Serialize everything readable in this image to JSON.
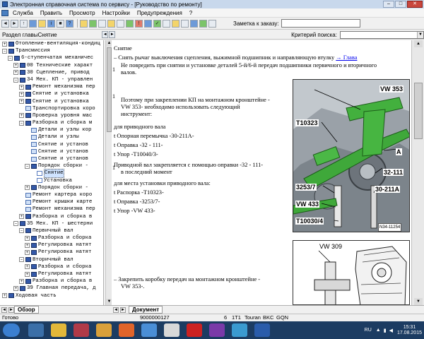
{
  "titlebar": {
    "title": "Электронная справочная система по сервису - [Руководство по ремонту]",
    "min": "–",
    "max": "□",
    "close": "✕"
  },
  "menu": [
    "Служба",
    "Править",
    "Просмотр",
    "Настройки",
    "Предупреждения",
    "?"
  ],
  "toolbar": {
    "order_label": "Заметка к заказу:"
  },
  "crumb": {
    "section": "Раздел главыСнятие",
    "search_label": "Критерий  поиска:"
  },
  "tree": [
    {
      "indent": 0,
      "ex": "+",
      "icon": "book",
      "label": "Отопление-вентиляция-кондиц"
    },
    {
      "indent": 0,
      "ex": "–",
      "icon": "book",
      "label": "Трансмиссия"
    },
    {
      "indent": 1,
      "ex": "–",
      "icon": "book",
      "label": "6-ступенчатая механичес"
    },
    {
      "indent": 2,
      "ex": "+",
      "icon": "book",
      "label": "00 Технические характ"
    },
    {
      "indent": 2,
      "ex": "+",
      "icon": "book",
      "label": "30 Сцепление, привод"
    },
    {
      "indent": 2,
      "ex": "–",
      "icon": "book",
      "label": "34 Мех. КП - управлен"
    },
    {
      "indent": 3,
      "ex": "+",
      "icon": "book",
      "label": "Ремонт механизма пер"
    },
    {
      "indent": 3,
      "ex": "+",
      "icon": "book",
      "label": "Снятие и установка"
    },
    {
      "indent": 3,
      "ex": "+",
      "icon": "book",
      "label": "Снятие и установка"
    },
    {
      "indent": 3,
      "ex": "",
      "icon": "doc2",
      "label": "Транспортировка коро"
    },
    {
      "indent": 3,
      "ex": "+",
      "icon": "book",
      "label": "Проверка уровня мас"
    },
    {
      "indent": 3,
      "ex": "–",
      "icon": "book",
      "label": "Разборка и сборка м"
    },
    {
      "indent": 4,
      "ex": "",
      "icon": "doc2",
      "label": "Детали и узлы кор"
    },
    {
      "indent": 4,
      "ex": "",
      "icon": "doc2",
      "label": "Детали и узлы"
    },
    {
      "indent": 4,
      "ex": "",
      "icon": "doc2",
      "label": "Снятие и установ"
    },
    {
      "indent": 4,
      "ex": "",
      "icon": "doc2",
      "label": "Снятие и установ"
    },
    {
      "indent": 4,
      "ex": "",
      "icon": "doc2",
      "label": "Снятие и установ"
    },
    {
      "indent": 4,
      "ex": "–",
      "icon": "book",
      "label": "Порядок сборки -"
    },
    {
      "indent": 5,
      "ex": "",
      "icon": "doc",
      "label": "Снятие",
      "selected": true
    },
    {
      "indent": 5,
      "ex": "",
      "icon": "doc",
      "label": "Установка"
    },
    {
      "indent": 4,
      "ex": "+",
      "icon": "book",
      "label": "Порядок сборки -"
    },
    {
      "indent": 3,
      "ex": "",
      "icon": "doc2",
      "label": "Ремонт картера коро"
    },
    {
      "indent": 3,
      "ex": "",
      "icon": "doc2",
      "label": "Ремонт крышки карте"
    },
    {
      "indent": 3,
      "ex": "",
      "icon": "doc2",
      "label": "Ремонт механизма пер"
    },
    {
      "indent": 3,
      "ex": "+",
      "icon": "book",
      "label": "Разборка и сборка в"
    },
    {
      "indent": 2,
      "ex": "–",
      "icon": "book",
      "label": "35 Мех. КП - шестерни"
    },
    {
      "indent": 3,
      "ex": "–",
      "icon": "book",
      "label": "Первичный вал"
    },
    {
      "indent": 4,
      "ex": "+",
      "icon": "book",
      "label": "Разборка и сборка"
    },
    {
      "indent": 4,
      "ex": "+",
      "icon": "book",
      "label": "Регулировка натят"
    },
    {
      "indent": 4,
      "ex": "+",
      "icon": "book",
      "label": "Регулировка натят"
    },
    {
      "indent": 3,
      "ex": "–",
      "icon": "book",
      "label": "Вторичный вал"
    },
    {
      "indent": 4,
      "ex": "+",
      "icon": "book",
      "label": "Разборка и сборка"
    },
    {
      "indent": 4,
      "ex": "+",
      "icon": "book",
      "label": "Регулировка натят"
    },
    {
      "indent": 3,
      "ex": "+",
      "icon": "book",
      "label": "Разборка и сборка в"
    },
    {
      "indent": 2,
      "ex": "+",
      "icon": "book",
      "label": "39 Главная передача, д"
    },
    {
      "indent": 0,
      "ex": "+",
      "icon": "book",
      "label": "Ходовая часть"
    }
  ],
  "left_tab": "Обзор",
  "doc_tab": "Документ",
  "doc": {
    "heading": "Снятие",
    "l1_pre": "–  Снять рычаг выключения сцепления, выжимной подшипник и направляющую втулку ",
    "l1_link": "→ Глава",
    "num": "1",
    "l2": "Не повредить при снятии и установке деталей 5-й/6-й передач подшипники первичного и вторичного",
    "l3": "валов.",
    "p1": "Поэтому при закреплении КП на монтажном кронштейне -",
    "p2": "VW 353- необходимо использовать следующий",
    "p3": "инструмент:",
    "p4": "для приводного вала",
    "t1": "t  Опорная перемычка -30-211А-",
    "t2": "t  Оправка -32 - 111-",
    "t3": "t  Упор -Т10040/3-",
    "p5": "Приводной вал закрепляется с помощью оправки -32 - 111-",
    "p6": "в последний момент",
    "p7": "для места установки приводного вала:",
    "t4": "t  Распорка -Т10323-",
    "t5": "t  Оправка -3253/7-",
    "t6": "t  Упор -VW 433-",
    "p8": "–  Закрепить коробку передач на монтажном кронштейне -",
    "p9": "VW 353-."
  },
  "figure1": {
    "labels": [
      "VW 353",
      "T10323",
      "A",
      "32-111",
      "3253/7",
      "30-211A",
      "VW 433",
      "T10030/4"
    ],
    "code": "N34-11254"
  },
  "figure2": {
    "label": "VW 309"
  },
  "status": {
    "ready": "Готово",
    "id": "9000000127",
    "c1": "6",
    "c2": "1T1",
    "c3": "Touran",
    "c4": "BKC",
    "c5": "GQN"
  },
  "taskbar": {
    "lang": "RU",
    "time": "15:31",
    "date": "17.08.2015"
  }
}
